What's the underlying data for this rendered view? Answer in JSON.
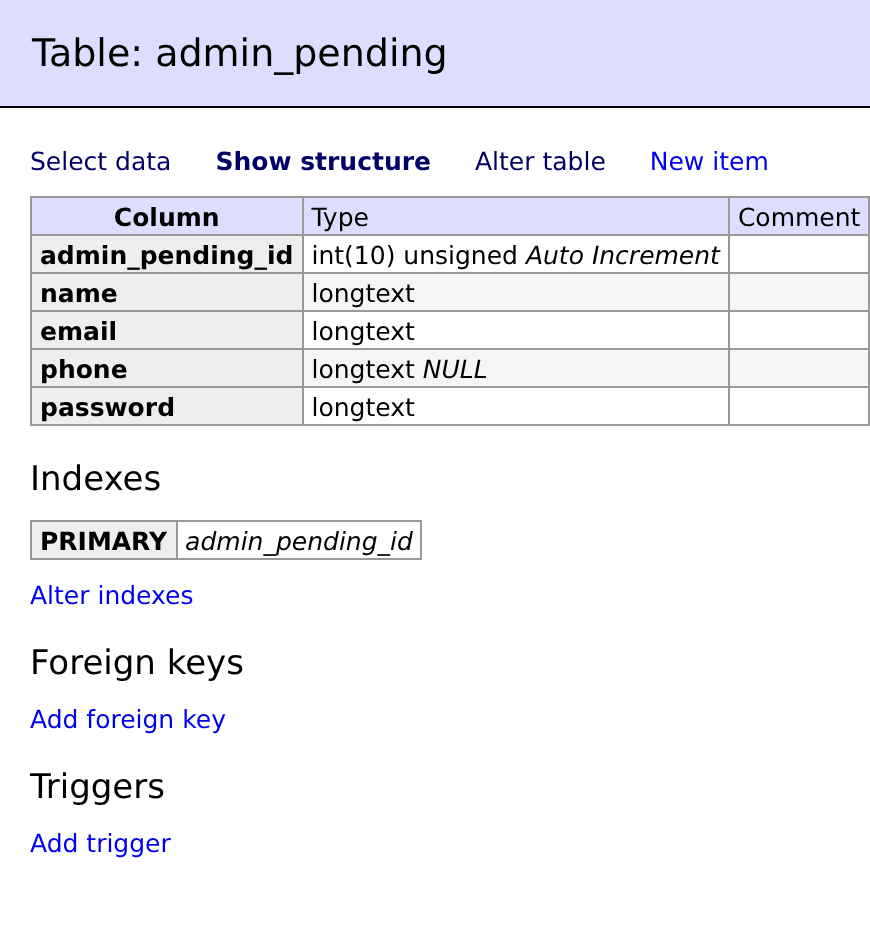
{
  "page": {
    "title": "Table: admin_pending"
  },
  "nav": [
    {
      "label": "Select data",
      "selected": false,
      "visited": true
    },
    {
      "label": "Show structure",
      "selected": true,
      "visited": true
    },
    {
      "label": "Alter table",
      "selected": false,
      "visited": true
    },
    {
      "label": "New item",
      "selected": false,
      "visited": false
    }
  ],
  "table": {
    "columns": [
      "Column",
      "Type",
      "Comment"
    ],
    "rows": [
      {
        "column": "admin_pending_id",
        "type": "int(10) unsigned *Auto Increment*"
      },
      {
        "column": "name",
        "type": "longtext"
      },
      {
        "column": "email",
        "type": "longtext"
      },
      {
        "column": "phone",
        "type": "longtext *NULL*"
      },
      {
        "column": "password",
        "type": "longtext"
      }
    ]
  },
  "sections": [
    {
      "heading": "Indexes",
      "indexes": [
        {
          "kind": "PRIMARY",
          "columns": "admin_pending_id"
        }
      ],
      "link": "Alter indexes"
    },
    {
      "heading": "Foreign keys",
      "link": "Add foreign key"
    },
    {
      "heading": "Triggers",
      "link": "Add trigger"
    }
  ]
}
